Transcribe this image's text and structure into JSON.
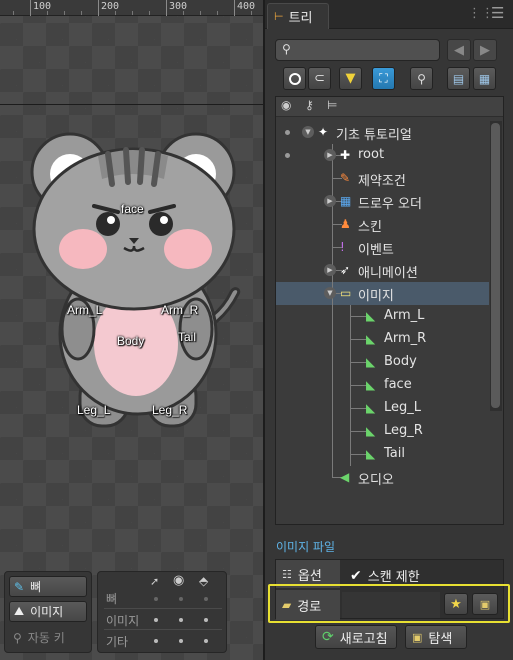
{
  "ruler": {
    "labels": [
      "100",
      "200",
      "300",
      "400"
    ]
  },
  "bones": {
    "face": "face",
    "arm_l": "Arm_L",
    "arm_r": "Arm_R",
    "body": "Body",
    "tail": "Tail",
    "leg_l": "Leg_L",
    "leg_r": "Leg_R"
  },
  "tools": {
    "bones_btn": "뼈",
    "images_btn": "이미지",
    "autokey_btn": "자동 키",
    "rows": [
      "뼈",
      "이미지",
      "기타"
    ]
  },
  "panel": {
    "tab_title": "트리",
    "tree": [
      {
        "label": "기초 튜토리얼",
        "level": 0,
        "icon": "skeleton-icon"
      },
      {
        "label": "root",
        "level": 1,
        "icon": "bone-root-icon"
      },
      {
        "label": "제약조건",
        "level": 1,
        "icon": "constraint-icon"
      },
      {
        "label": "드로우 오더",
        "level": 1,
        "icon": "draw-order-icon"
      },
      {
        "label": "스킨",
        "level": 1,
        "icon": "skin-icon"
      },
      {
        "label": "이벤트",
        "level": 1,
        "icon": "event-icon"
      },
      {
        "label": "애니메이션",
        "level": 1,
        "icon": "animation-icon"
      },
      {
        "label": "이미지",
        "level": 1,
        "icon": "images-folder-icon",
        "selected": true
      },
      {
        "label": "Arm_L",
        "level": 2,
        "icon": "image-file-icon"
      },
      {
        "label": "Arm_R",
        "level": 2,
        "icon": "image-file-icon"
      },
      {
        "label": "Body",
        "level": 2,
        "icon": "image-file-icon"
      },
      {
        "label": "face",
        "level": 2,
        "icon": "image-file-icon"
      },
      {
        "label": "Leg_L",
        "level": 2,
        "icon": "image-file-icon"
      },
      {
        "label": "Leg_R",
        "level": 2,
        "icon": "image-file-icon"
      },
      {
        "label": "Tail",
        "level": 2,
        "icon": "image-file-icon"
      },
      {
        "label": "오디오",
        "level": 1,
        "icon": "audio-icon"
      }
    ],
    "section_title": "이미지 파일",
    "options_label": "옵션",
    "scan_label": "스캔 제한",
    "scan_checked": true,
    "path_label": "경로",
    "refresh_btn": "새로고침",
    "browse_btn": "탐색"
  }
}
